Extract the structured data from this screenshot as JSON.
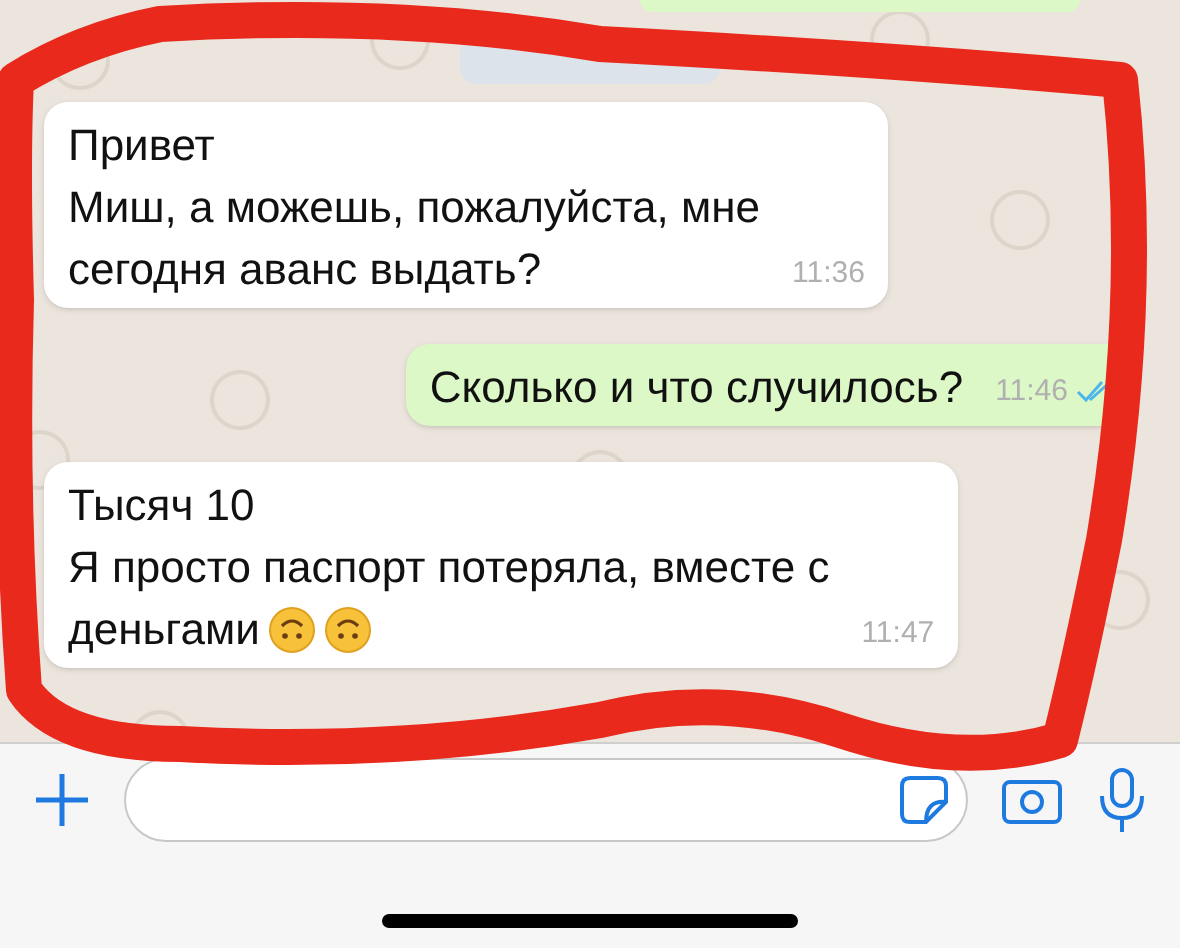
{
  "messages": [
    {
      "kind": "incoming",
      "lines": [
        "Привет",
        "Миш, а можешь, пожалуйста, мне",
        "сегодня аванс выдать?"
      ],
      "time": "11:36"
    },
    {
      "kind": "outgoing",
      "lines": [
        "Сколько и что случилось?"
      ],
      "time": "11:46",
      "read": true
    },
    {
      "kind": "incoming",
      "lines": [
        "Тысяч 10",
        "Я просто паспорт потеряла, вместе с",
        "деньгами"
      ],
      "trailing_icons": [
        {
          "kind": "emoji"
        },
        {
          "kind": "emoji"
        }
      ],
      "time": "11:47"
    }
  ]
}
